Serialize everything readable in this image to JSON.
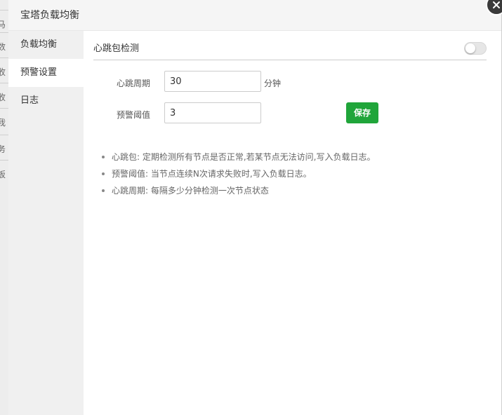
{
  "background": {
    "rows": [
      "马",
      "数",
      "收",
      "收",
      "我",
      "务",
      "板"
    ]
  },
  "dialog": {
    "title": "宝塔负载均衡",
    "close_icon": "close-icon"
  },
  "sidebar": {
    "items": [
      {
        "label": "负载均衡",
        "active": false
      },
      {
        "label": "预警设置",
        "active": true
      },
      {
        "label": "日志",
        "active": false
      }
    ]
  },
  "section": {
    "title": "心跳包检测",
    "toggle_on": false
  },
  "form": {
    "period_label": "心跳周期",
    "period_value": "30",
    "period_unit": "分钟",
    "threshold_label": "预警阈值",
    "threshold_value": "3",
    "save_label": "保存"
  },
  "tips": [
    "心跳包: 定期检测所有节点是否正常,若某节点无法访问,写入负载日志。",
    "预警阈值: 当节点连续N次请求失败时,写入负载日志。",
    "心跳周期: 每隔多少分钟检测一次节点状态"
  ],
  "colors": {
    "accent": "#20a53a",
    "close_bg": "#3a3a3a"
  }
}
